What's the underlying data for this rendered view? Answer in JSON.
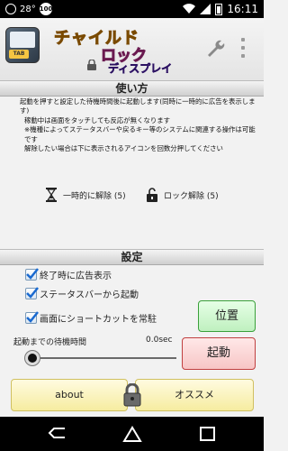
{
  "status_bar": {
    "temperature": "28°",
    "badge": "100",
    "time": "16:11"
  },
  "header": {
    "logo_line1": "チャイルド",
    "logo_line2": "ロック",
    "logo_line3": "ディスプレイ",
    "app_icon_badge": "TAB"
  },
  "howto": {
    "title": "使い方",
    "lines": [
      "起動を押すと設定した待機時間後に起動します(同時に一時的に広告を表示します)",
      "稼動中は画面をタッチしても反応が無くなります",
      "※機種によってステータスバーや戻るキー等のシステムに関連する操作は可能です",
      "解除したい場合は下に表示されるアイコンを回数分押してください"
    ],
    "legend_temp": "一時的に解除 (5)",
    "legend_lock": "ロック解除 (5)"
  },
  "settings": {
    "title": "設定",
    "checkbox1": "終了時に広告表示",
    "checkbox2": "ステータスバーから起動",
    "checkbox3": "画面にショートカットを常駐",
    "position_button": "位置",
    "start_button": "起動",
    "wait_label": "起動までの待機時間",
    "wait_value": "0.0sec"
  },
  "bottom": {
    "about": "about",
    "recommend": "オススメ"
  }
}
